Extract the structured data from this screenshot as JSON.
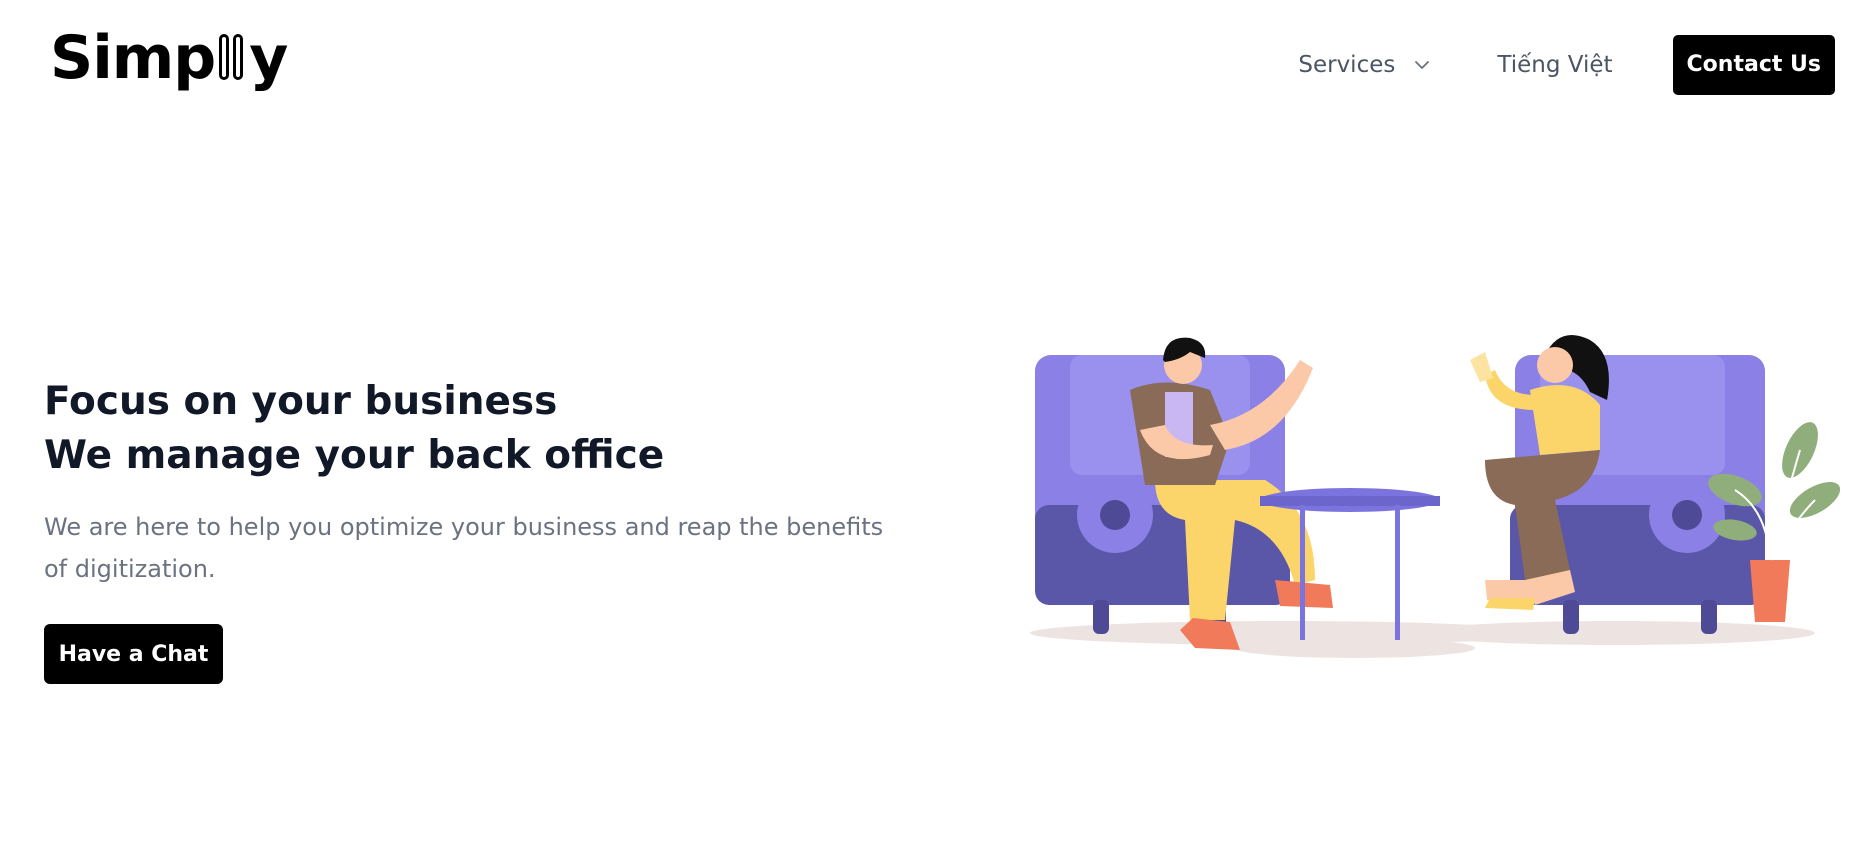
{
  "header": {
    "logo_text_start": "Simp",
    "logo_text_end": "y",
    "nav": {
      "services_label": "Services",
      "language_label": "Tiếng Việt",
      "contact_label": "Contact Us"
    }
  },
  "hero": {
    "title_line1": "Focus on your business",
    "title_line2": "We manage your back office",
    "subtitle": "We are here to help you optimize your business and reap the benefits of digitization.",
    "cta_label": "Have a Chat"
  },
  "colors": {
    "sofa": "#8b80e6",
    "sofa_dark": "#5a56a8",
    "yellow": "#fcd56a",
    "brown": "#8a6b57",
    "coral": "#f07a5a",
    "plant": "#8fae7b"
  }
}
